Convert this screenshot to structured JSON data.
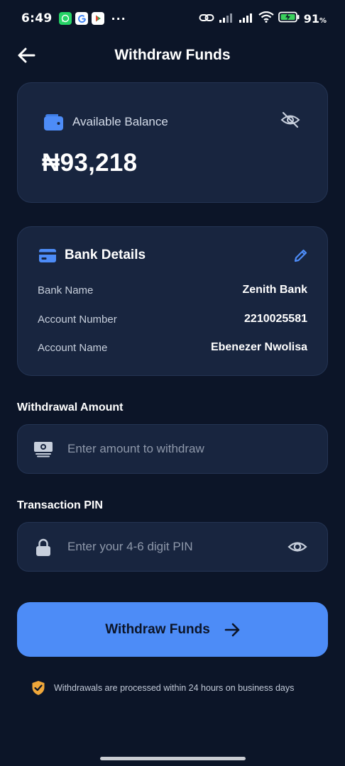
{
  "status_bar": {
    "time": "6:49",
    "dots": "···",
    "battery_percent": "91",
    "battery_unit": "%"
  },
  "header": {
    "title": "Withdraw Funds"
  },
  "balance": {
    "label": "Available Balance",
    "amount": "₦93,218"
  },
  "bank": {
    "title": "Bank Details",
    "rows": [
      {
        "label": "Bank Name",
        "value": "Zenith Bank"
      },
      {
        "label": "Account Number",
        "value": "2210025581"
      },
      {
        "label": "Account Name",
        "value": "Ebenezer Nwolisa"
      }
    ]
  },
  "amount_field": {
    "label": "Withdrawal Amount",
    "placeholder": "Enter amount to withdraw",
    "value": ""
  },
  "pin_field": {
    "label": "Transaction PIN",
    "placeholder": "Enter your 4-6 digit PIN",
    "value": ""
  },
  "submit": {
    "label": "Withdraw Funds"
  },
  "notice": {
    "text": "Withdrawals are processed within 24 hours on business days"
  },
  "colors": {
    "background": "#0c1528",
    "card": "#18253f",
    "accent": "#4d8cf7",
    "notice_icon": "#f0a73a"
  }
}
